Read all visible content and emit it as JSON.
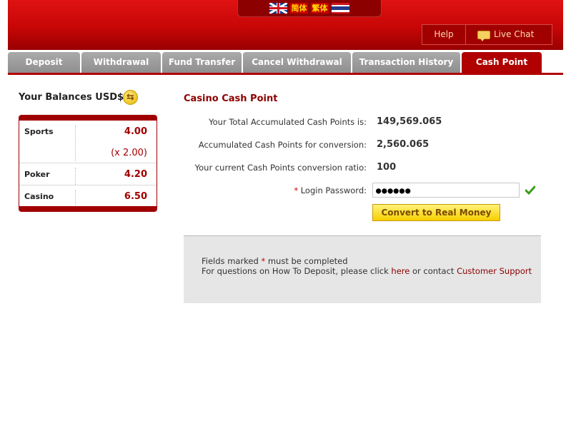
{
  "header": {
    "languages": [
      "English",
      "简体",
      "繁体",
      "Thai"
    ],
    "help_label": "Help",
    "live_chat_label": "Live Chat",
    "cn_simplified": "简体",
    "cn_traditional": "繁体"
  },
  "tabs": [
    {
      "label": "Deposit"
    },
    {
      "label": "Withdrawal"
    },
    {
      "label": "Fund Transfer"
    },
    {
      "label": "Cancel Withdrawal"
    },
    {
      "label": "Transaction History"
    },
    {
      "label": "Cash Point",
      "active": true
    }
  ],
  "balances": {
    "title": "Your Balances USD$",
    "rows": [
      {
        "label": "Sports",
        "value": "4.00",
        "multiplier": "(x 2.00)"
      },
      {
        "label": "Poker",
        "value": "4.20"
      },
      {
        "label": "Casino",
        "value": "6.50"
      }
    ]
  },
  "main": {
    "title": "Casino Cash Point",
    "total_label": "Your Total Accumulated Cash Points is:",
    "total_value": "149,569.065",
    "conversion_label": "Accumulated Cash Points for conversion:",
    "conversion_value": "2,560.065",
    "ratio_label": "Your current Cash Points conversion ratio:",
    "ratio_value": "100",
    "password_required_mark": "*",
    "password_label": "Login Password:",
    "password_value": "●●●●●●",
    "convert_button": "Convert to Real Money"
  },
  "notes": {
    "line1_prefix": "Fields marked",
    "line1_mark": "*",
    "line1_suffix": "must be completed",
    "line2_prefix": "For questions on How To Deposit, please click",
    "line2_here": "here",
    "line2_middle": "or contact",
    "line2_support": "Customer Support"
  },
  "colors": {
    "brand_red": "#b00000",
    "header_red": "#c70606",
    "button_yellow": "#f7cf00",
    "tab_gray": "#999999"
  }
}
